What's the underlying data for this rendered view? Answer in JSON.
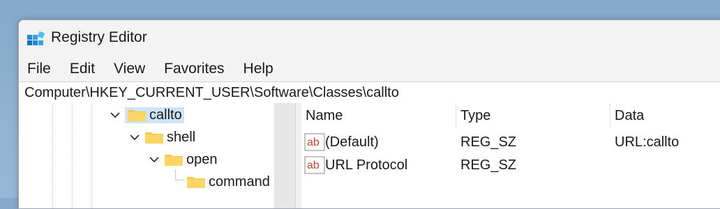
{
  "window": {
    "title": "Registry Editor"
  },
  "menu": {
    "items": [
      "File",
      "Edit",
      "View",
      "Favorites",
      "Help"
    ]
  },
  "address_bar": {
    "path": "Computer\\HKEY_CURRENT_USER\\Software\\Classes\\callto"
  },
  "tree": {
    "nodes": [
      {
        "label": "callto",
        "expanded": true,
        "selected": true,
        "icon": "folder-icon"
      },
      {
        "label": "shell",
        "expanded": true,
        "selected": false,
        "icon": "folder-icon"
      },
      {
        "label": "open",
        "expanded": true,
        "selected": false,
        "icon": "folder-icon"
      },
      {
        "label": "command",
        "expanded": false,
        "selected": false,
        "icon": "folder-icon"
      }
    ]
  },
  "list": {
    "columns": [
      "Name",
      "Type",
      "Data"
    ],
    "rows": [
      {
        "name": "(Default)",
        "type": "REG_SZ",
        "data": "URL:callto",
        "icon": "string-value-icon"
      },
      {
        "name": "URL Protocol",
        "type": "REG_SZ",
        "data": "",
        "icon": "string-value-icon"
      }
    ]
  },
  "colors": {
    "selection": "#cfe4f7",
    "folder": "#f8c84a",
    "value_icon_text": "#d2452a",
    "desktop": "#8fb0cf"
  }
}
